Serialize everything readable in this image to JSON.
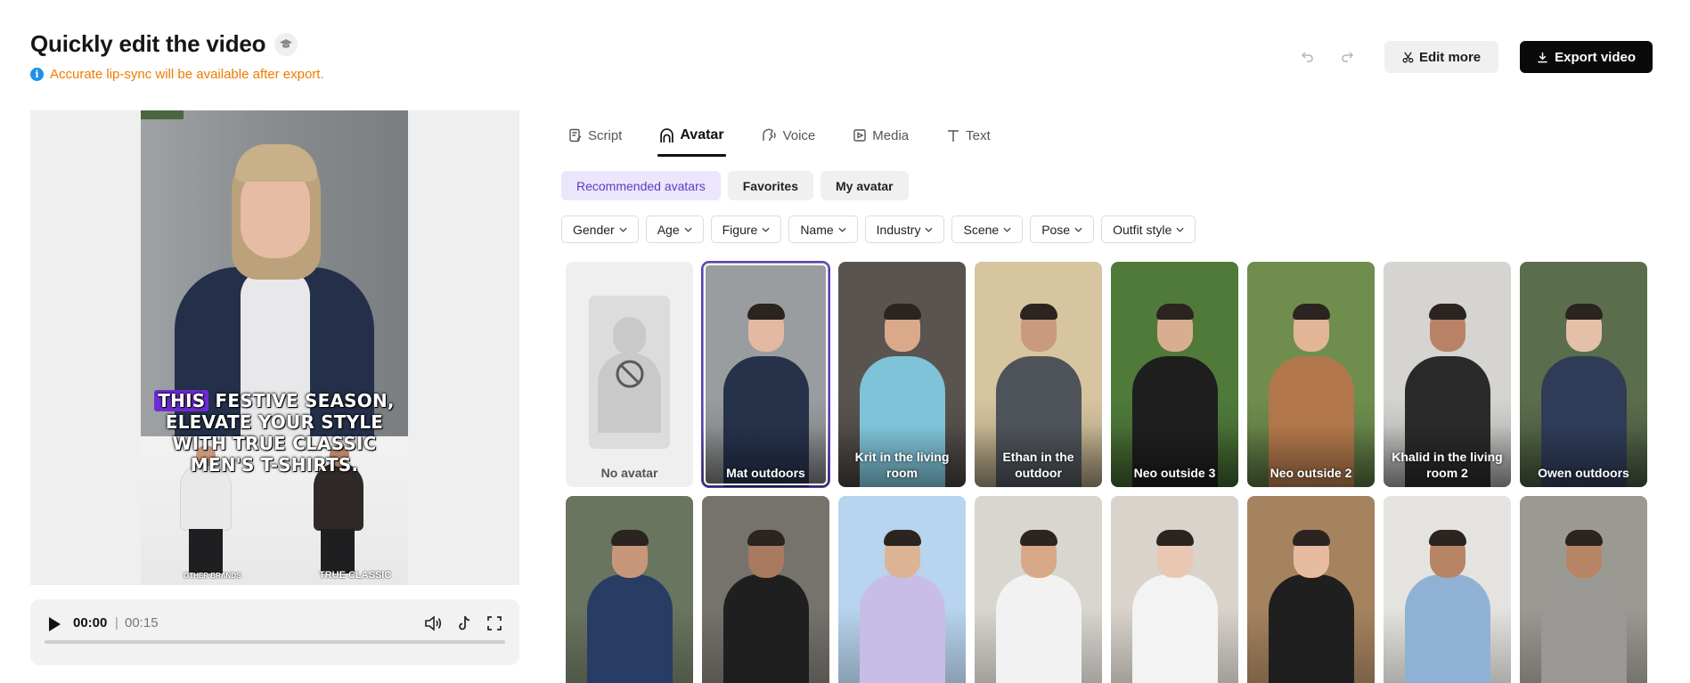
{
  "header": {
    "title": "Quickly edit the video",
    "notice": "Accurate lip-sync will be available after export.",
    "edit_more": "Edit more",
    "export": "Export video"
  },
  "preview": {
    "caption_highlight": "THIS",
    "caption_rest_line1": " FESTIVE SEASON,",
    "caption_line2": "ELEVATE YOUR STYLE",
    "caption_line3": "WITH TRUE CLASSIC",
    "caption_line4": "MEN'S T-SHIRTS.",
    "brand_left": "OTHER BRANDS",
    "brand_right": "TRUE CLASSIC"
  },
  "player": {
    "current_time": "00:00",
    "separator": "|",
    "total_time": "00:15",
    "progress": 0
  },
  "tabs": [
    {
      "label": "Script",
      "icon": "script-icon"
    },
    {
      "label": "Avatar",
      "icon": "avatar-icon",
      "active": true
    },
    {
      "label": "Voice",
      "icon": "voice-icon"
    },
    {
      "label": "Media",
      "icon": "media-icon"
    },
    {
      "label": "Text",
      "icon": "text-icon"
    }
  ],
  "subtabs": [
    {
      "label": "Recommended avatars",
      "active": true
    },
    {
      "label": "Favorites"
    },
    {
      "label": "My avatar"
    }
  ],
  "filters": [
    "Gender",
    "Age",
    "Figure",
    "Name",
    "Industry",
    "Scene",
    "Pose",
    "Outfit style"
  ],
  "avatars_row1": [
    {
      "label": "No avatar",
      "bg": "#efefef",
      "shirt": "",
      "skin": ""
    },
    {
      "label": "Mat outdoors",
      "bg": "#9a9d9f",
      "shirt": "#26314a",
      "skin": "#e3b9a3",
      "selected": true
    },
    {
      "label": "Krit in the living room",
      "bg": "#5a5450",
      "shirt": "#7fc3d8",
      "skin": "#d9a989"
    },
    {
      "label": "Ethan in the outdoor",
      "bg": "#d7c59f",
      "shirt": "#4e535a",
      "skin": "#c99a7c"
    },
    {
      "label": "Neo outside 3",
      "bg": "#4f7a3a",
      "shirt": "#1e1e1e",
      "skin": "#d9ae90"
    },
    {
      "label": "Neo outside 2",
      "bg": "#6f8e4e",
      "shirt": "#b1774b",
      "skin": "#e2b596"
    },
    {
      "label": "Khalid in the living room 2",
      "bg": "#d5d4d1",
      "shirt": "#2a2a2a",
      "skin": "#b98266"
    },
    {
      "label": "Owen outdoors",
      "bg": "#5a6d4c",
      "shirt": "#2f3c58",
      "skin": "#e5c0a8"
    }
  ],
  "avatars_row2": [
    {
      "bg": "#6a7560",
      "shirt": "#283c64",
      "skin": "#c8977b"
    },
    {
      "bg": "#76736d",
      "shirt": "#1f1f1f",
      "skin": "#a97a5f"
    },
    {
      "bg": "#b8d4ee",
      "shirt": "#c7bde6",
      "skin": "#dcb395"
    },
    {
      "bg": "#d9d6d0",
      "shirt": "#f2f2f2",
      "skin": "#d8a989"
    },
    {
      "bg": "#d9d3cb",
      "shirt": "#f3f3f3",
      "skin": "#e9c7b2"
    },
    {
      "bg": "#a5835f",
      "shirt": "#1f1f1f",
      "skin": "#e6bb9f"
    },
    {
      "bg": "#e5e3df",
      "shirt": "#8fb2d4",
      "skin": "#b88466"
    },
    {
      "bg": "#9b9a92",
      "shirt": "#9a9894",
      "skin": "#b88466"
    }
  ],
  "colors": {
    "accent": "#5b3cc4",
    "notice": "#f07a00",
    "info": "#1d8fe8",
    "export_bg": "#0a0a0a"
  }
}
